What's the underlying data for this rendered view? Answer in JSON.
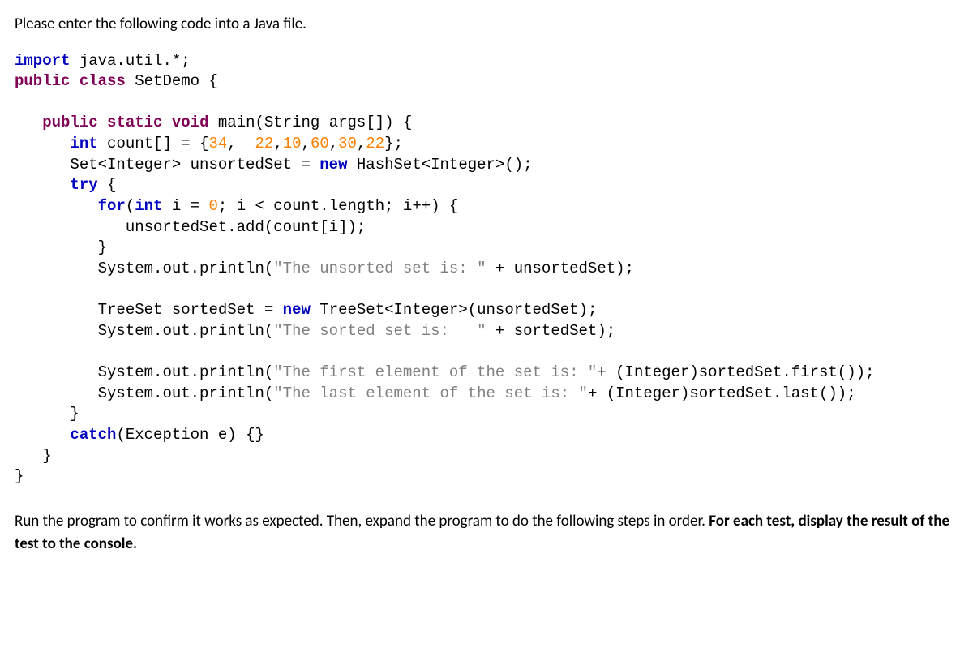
{
  "intro": "Please enter the following code into a Java file.",
  "kw": {
    "import": "import",
    "public": "public",
    "class": "class",
    "static": "static",
    "void": "void",
    "int": "int",
    "new": "new",
    "try": "try",
    "for": "for",
    "catch": "catch"
  },
  "code": {
    "l1_a": " java.util.*;",
    "l2_a": " SetDemo {",
    "l4_a": " main(String args[]) {",
    "l5_a": " count[] = {",
    "l5_n1": "34",
    "l5_b": ",  ",
    "l5_n2": "22",
    "l5_c": ",",
    "l5_n3": "10",
    "l5_d": ",",
    "l5_n4": "60",
    "l5_e": ",",
    "l5_n5": "30",
    "l5_f": ",",
    "l5_n6": "22",
    "l5_g": "};",
    "l6_a": "Set<Integer> unsortedSet = ",
    "l6_b": " HashSet<Integer>();",
    "l7_a": " {",
    "l8_a": "(",
    "l8_b": " i = ",
    "l8_n": "0",
    "l8_c": "; i < count.length; i++) {",
    "l9": "unsortedSet.add(count[i]);",
    "l10": "}",
    "l11_a": "System.out.println(",
    "l11_s": "\"The unsorted set is: \"",
    "l11_b": " + unsortedSet);",
    "l13_a": "TreeSet sortedSet = ",
    "l13_b": " TreeSet<Integer>(unsortedSet);",
    "l14_a": "System.out.println(",
    "l14_s": "\"The sorted set is:   \"",
    "l14_b": " + sortedSet);",
    "l16_a": "System.out.println(",
    "l16_s": "\"The first element of the set is: \"",
    "l16_b": "+ (Integer)sortedSet.first());",
    "l17_a": "System.out.println(",
    "l17_s": "\"The last element of the set is: \"",
    "l17_b": "+ (Integer)sortedSet.last());",
    "l18": "}",
    "l19_a": "(Exception e) {}",
    "l20": "}",
    "l21": "}"
  },
  "followup": {
    "part1": "Run the program to confirm it works as expected. Then, expand the program to do the following steps in order. ",
    "part2": "For each test, display the result of the test to the console."
  }
}
